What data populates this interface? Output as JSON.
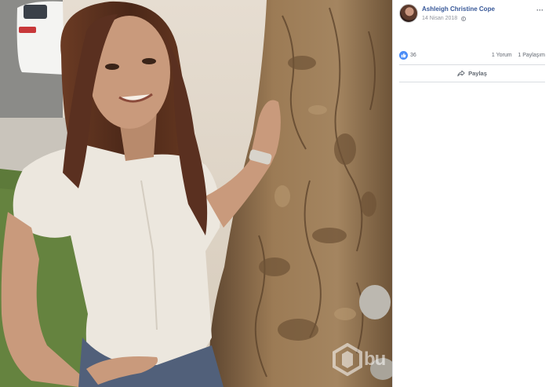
{
  "post": {
    "author": "Ashleigh Christine Cope",
    "date": "14 Nisan 2018",
    "audience_icon": "globe-icon",
    "options_icon": "more-options-icon"
  },
  "reactions": {
    "icon": "like-icon",
    "count": "36",
    "comments": "1 Yorum",
    "shares": "1 Paylaşım"
  },
  "actions": {
    "share_label": "Paylaş",
    "share_icon": "share-arrow-icon"
  },
  "photo": {
    "watermark_icon": "watermark-logo-icon",
    "watermark_text": "bu",
    "colors": {
      "bark": "#8a6a45",
      "shirt": "#ede8df",
      "hair": "#4a2a1c",
      "skin": "#c99a7c",
      "grass": "#5d7a3a"
    }
  },
  "colors": {
    "author": "#385898",
    "meta": "#90949c",
    "like_badge": "#4a8cf7",
    "divider": "#dadde1"
  }
}
